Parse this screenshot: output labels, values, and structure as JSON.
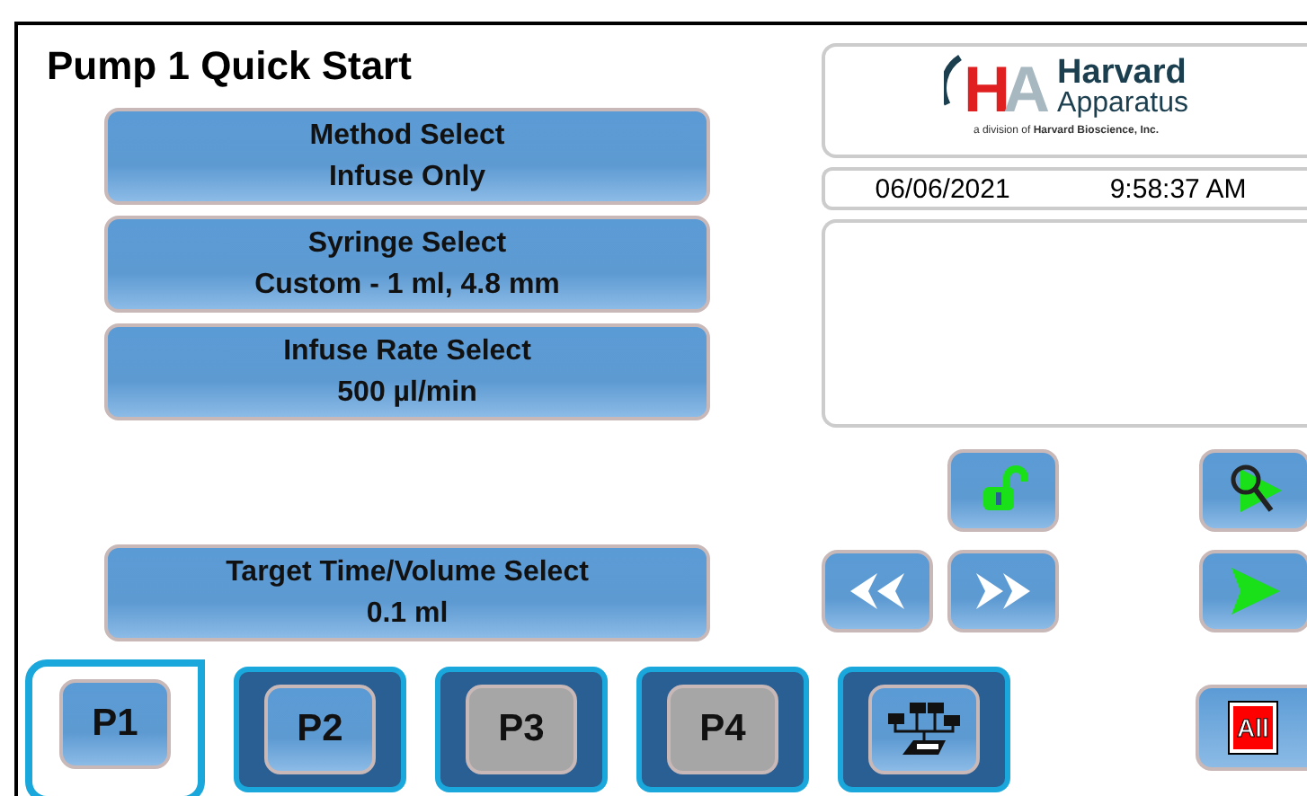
{
  "screen": {
    "title": "Pump 1 Quick Start"
  },
  "settings": [
    {
      "label": "Method Select",
      "value": "Infuse Only"
    },
    {
      "label": "Syringe Select",
      "value": "Custom - 1 ml, 4.8 mm"
    },
    {
      "label": "Infuse Rate Select",
      "value": "500 µl/min"
    }
  ],
  "target": {
    "label": "Target Time/Volume Select",
    "value": "0.1 ml"
  },
  "logo": {
    "mark": "HA",
    "name": "Harvard",
    "subname": "Apparatus",
    "tagline": "a division of **Harvard Bioscience, Inc.**"
  },
  "clock": {
    "date": "06/06/2021",
    "time": "9:58:37 AM"
  },
  "controls": [
    {
      "kind": "lock"
    },
    {
      "kind": "search"
    },
    {
      "kind": "rewind"
    },
    {
      "kind": "forward"
    },
    {
      "kind": "play"
    }
  ],
  "tabs": [
    {
      "kind": "pump",
      "label": "P1",
      "selected": true,
      "disabled": false
    },
    {
      "kind": "pump",
      "label": "P2",
      "selected": false,
      "disabled": false
    },
    {
      "kind": "pump",
      "label": "P3",
      "selected": false,
      "disabled": true
    },
    {
      "kind": "pump",
      "label": "P4",
      "selected": false,
      "disabled": true
    },
    {
      "kind": "network",
      "selected": false,
      "disabled": false
    }
  ],
  "all_button": {
    "label": "All"
  }
}
